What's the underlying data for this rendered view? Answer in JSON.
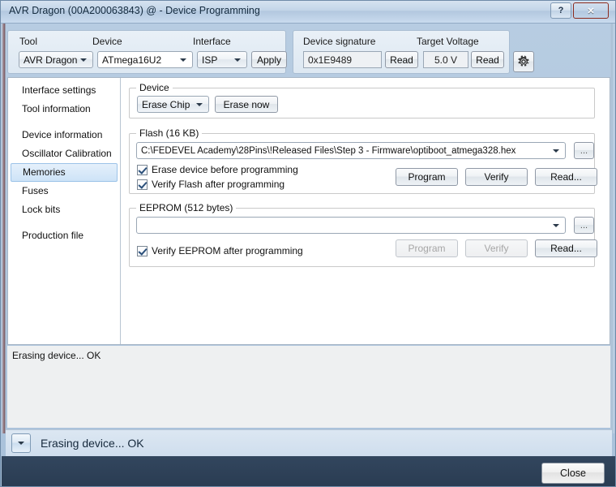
{
  "window": {
    "title": "AVR Dragon (00A200063843) @  - Device Programming",
    "help_button": "?",
    "close_button": "✕"
  },
  "toolbar": {
    "tool_label": "Tool",
    "tool_value": "AVR Dragon",
    "device_label": "Device",
    "device_value": "ATmega16U2",
    "interface_label": "Interface",
    "interface_value": "ISP",
    "apply_label": "Apply",
    "signature_label": "Device signature",
    "signature_value": "0x1E9489",
    "signature_read_label": "Read",
    "voltage_label": "Target Voltage",
    "voltage_value": "5.0 V",
    "voltage_read_label": "Read",
    "settings_icon": "gear-icon"
  },
  "sidebar": {
    "items": [
      {
        "label": "Interface settings",
        "selected": false,
        "gap_after": false
      },
      {
        "label": "Tool information",
        "selected": false,
        "gap_after": true
      },
      {
        "label": "Device information",
        "selected": false,
        "gap_after": false
      },
      {
        "label": "Oscillator Calibration",
        "selected": false,
        "gap_after": false
      },
      {
        "label": "Memories",
        "selected": true,
        "gap_after": false
      },
      {
        "label": "Fuses",
        "selected": false,
        "gap_after": false
      },
      {
        "label": "Lock bits",
        "selected": false,
        "gap_after": true
      },
      {
        "label": "Production file",
        "selected": false,
        "gap_after": false
      }
    ]
  },
  "device_section": {
    "legend": "Device",
    "erase_mode_value": "Erase Chip",
    "erase_now_label": "Erase now"
  },
  "flash_section": {
    "legend": "Flash (16 KB)",
    "file_path": "C:\\FEDEVEL Academy\\28Pins\\!Released Files\\Step 3 - Firmware\\optiboot_atmega328.hex",
    "browse_label": "...",
    "erase_before_program_label": "Erase device before programming",
    "erase_before_program_checked": true,
    "verify_after_program_label": "Verify Flash after programming",
    "verify_after_program_checked": true,
    "program_label": "Program",
    "verify_label": "Verify",
    "read_label": "Read..."
  },
  "eeprom_section": {
    "legend": "EEPROM (512 bytes)",
    "file_path": "",
    "browse_label": "...",
    "verify_after_program_label": "Verify EEPROM after programming",
    "verify_after_program_checked": true,
    "program_label": "Program",
    "program_enabled": false,
    "verify_label": "Verify",
    "verify_enabled": false,
    "read_label": "Read...",
    "read_enabled": true
  },
  "log": {
    "text": "Erasing device... OK"
  },
  "statusbar": {
    "expander_icon": "chevron-down-icon",
    "text": "Erasing device... OK"
  },
  "footer": {
    "close_label": "Close"
  },
  "colors": {
    "accent": "#2a4f7a",
    "selection": "#cde3f7",
    "close_red": "#c2372a",
    "footer": "#32465e"
  }
}
